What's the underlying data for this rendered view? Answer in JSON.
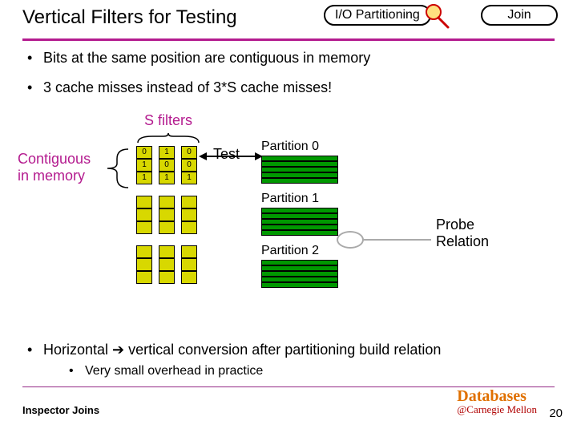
{
  "header": {
    "title": "Vertical Filters for Testing",
    "io_btn": "I/O Partitioning",
    "join_btn": "Join"
  },
  "bullets": {
    "b1": "Bits at the same position are contiguous in memory",
    "b2": "3 cache misses instead of 3*S cache misses!"
  },
  "diagram": {
    "sfilters": "S filters",
    "contiguous_l1": "Contiguous",
    "contiguous_l2": "in memory",
    "test": "Test",
    "filter_cells": {
      "c0": [
        "0",
        "1",
        "1"
      ],
      "c1": [
        "1",
        "0",
        "1"
      ],
      "c2": [
        "0",
        "0",
        "1"
      ]
    },
    "partitions": [
      "Partition 0",
      "Partition 1",
      "Partition 2"
    ],
    "partition_rows": 5,
    "probe_l1": "Probe",
    "probe_l2": "Relation"
  },
  "bottom": {
    "main_pre": "Horizontal ",
    "main_arrow": "➔",
    "main_post": " vertical conversion after partitioning build relation",
    "sub": "Very small overhead in practice"
  },
  "footer": {
    "left": "Inspector Joins",
    "db": "Databases",
    "cmu": "@Carnegie Mellon",
    "page": "20"
  }
}
